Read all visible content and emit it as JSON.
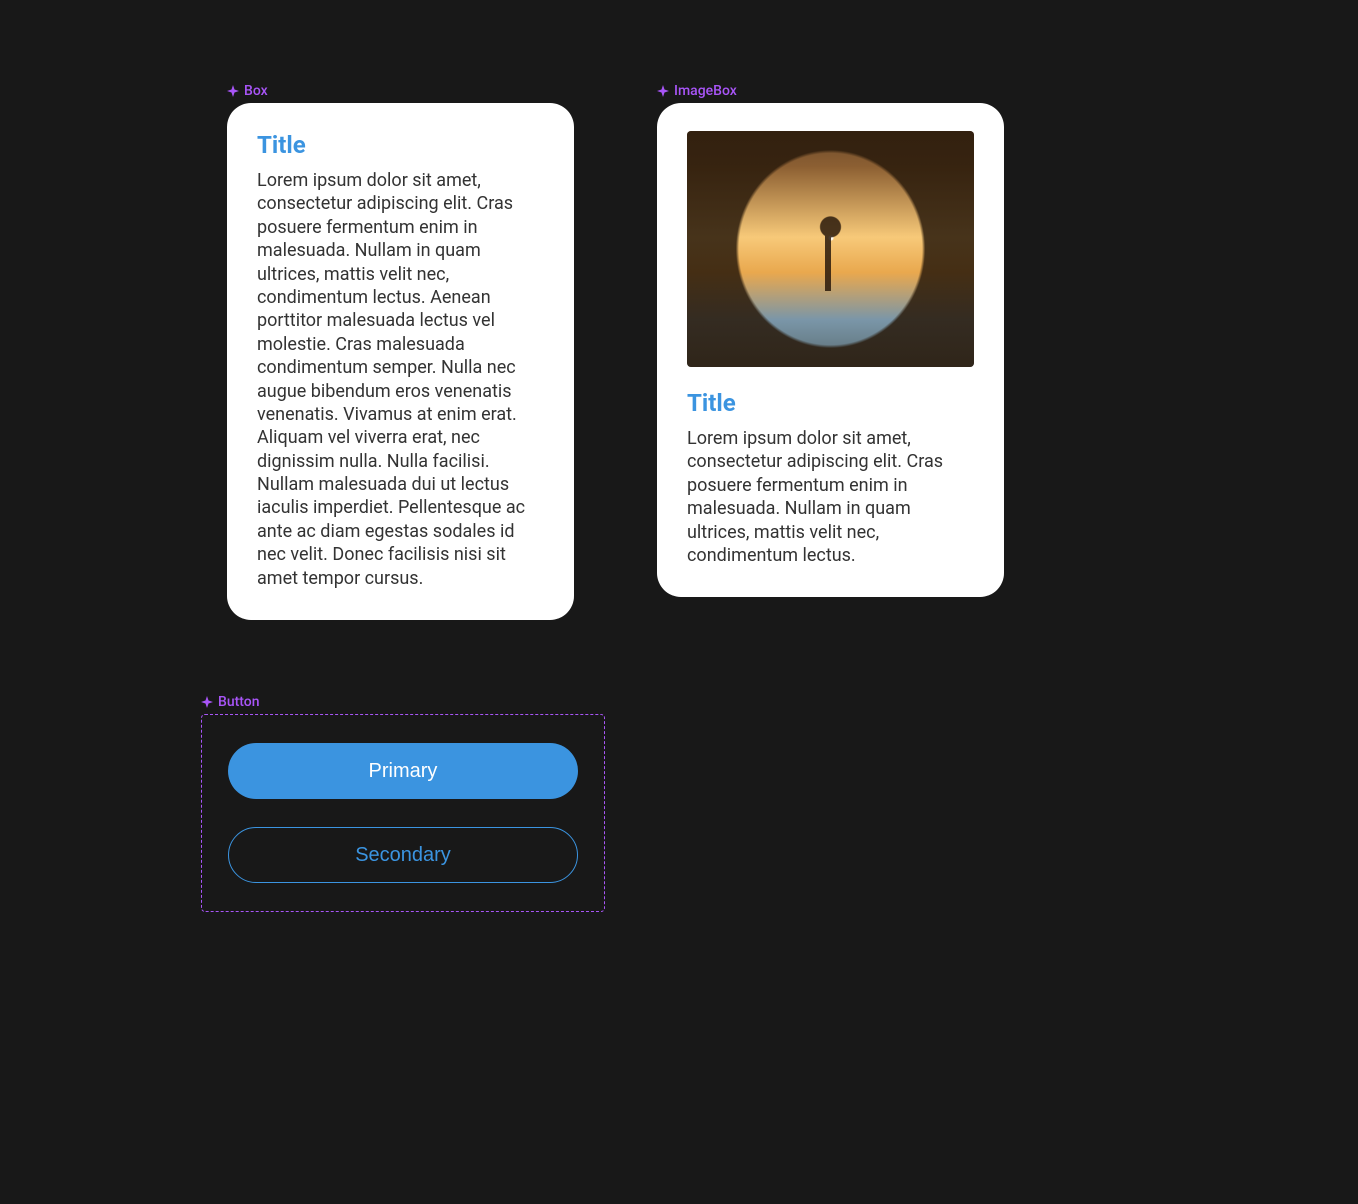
{
  "labels": {
    "box": "Box",
    "imageBox": "ImageBox",
    "button": "Button"
  },
  "box": {
    "title": "Title",
    "body": "Lorem ipsum dolor sit amet, consectetur adipiscing elit. Cras posuere fermentum enim in malesuada. Nullam in quam ultrices, mattis velit nec, condimentum lectus. Aenean porttitor malesuada lectus vel molestie. Cras malesuada condimentum semper. Nulla nec augue bibendum eros venenatis venenatis. Vivamus at enim erat. Aliquam vel viverra erat, nec dignissim nulla. Nulla facilisi. Nullam malesuada dui ut lectus iaculis imperdiet. Pellentesque ac ante ac diam egestas sodales id nec velit. Donec facilisis nisi sit amet tempor cursus."
  },
  "imageBox": {
    "title": "Title",
    "body": "Lorem ipsum dolor sit amet, consectetur adipiscing elit. Cras posuere fermentum enim in malesuada. Nullam in quam ultrices, mattis velit nec, condimentum lectus."
  },
  "buttons": {
    "primary": "Primary",
    "secondary": "Secondary"
  }
}
